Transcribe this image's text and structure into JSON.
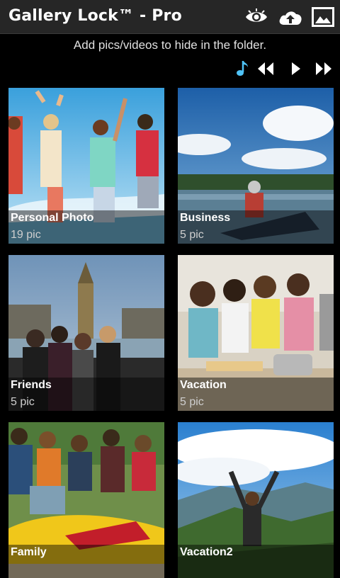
{
  "app": {
    "title": "Gallery Lock™ - Pro"
  },
  "toolbar": {
    "icons": [
      "eye-icon",
      "cloud-upload-icon",
      "gallery-icon"
    ]
  },
  "hint": "Add pics/videos to hide in the folder.",
  "playback": {
    "icons": [
      "music-note-icon",
      "rewind-icon",
      "play-icon",
      "fast-forward-icon"
    ],
    "accent": "#4fc3f7"
  },
  "folders": [
    {
      "name": "Personal Photo",
      "count": "19 pic"
    },
    {
      "name": "Business",
      "count": "5 pic"
    },
    {
      "name": "Friends",
      "count": "5 pic"
    },
    {
      "name": "Vacation",
      "count": "5 pic"
    },
    {
      "name": "Family",
      "count": ""
    },
    {
      "name": "Vacation2",
      "count": ""
    }
  ]
}
